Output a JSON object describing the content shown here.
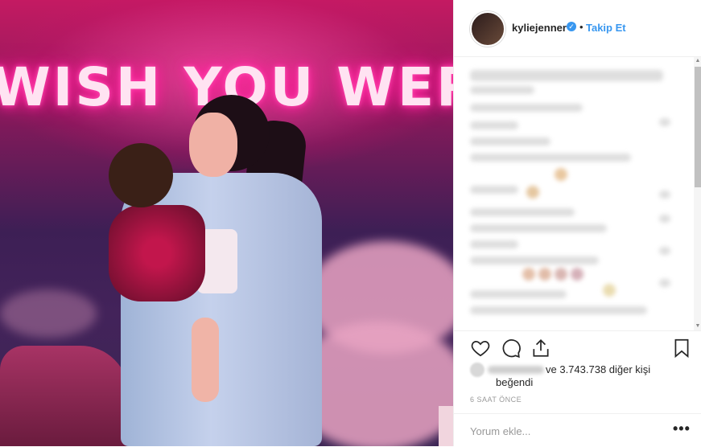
{
  "post": {
    "photo": {
      "neon_text": "WISH YOU WERE"
    },
    "header": {
      "username": "kyliejenner",
      "verified_icon": "verified-badge-icon",
      "separator": "•",
      "follow_label": "Takip Et"
    },
    "actions": {
      "icons": [
        "heart-icon",
        "comment-icon",
        "share-icon",
        "bookmark-icon"
      ]
    },
    "likes": {
      "text_part1": "ve 3.743.738 diğer kişi",
      "text_part2": "beğendi"
    },
    "timestamp": "6 SAAT ÖNCE",
    "comment_box": {
      "placeholder": "Yorum ekle...",
      "more_label": "•••"
    }
  },
  "colors": {
    "link_blue": "#3897f0",
    "border": "#efefef",
    "neon_pink": "#ff1493"
  }
}
